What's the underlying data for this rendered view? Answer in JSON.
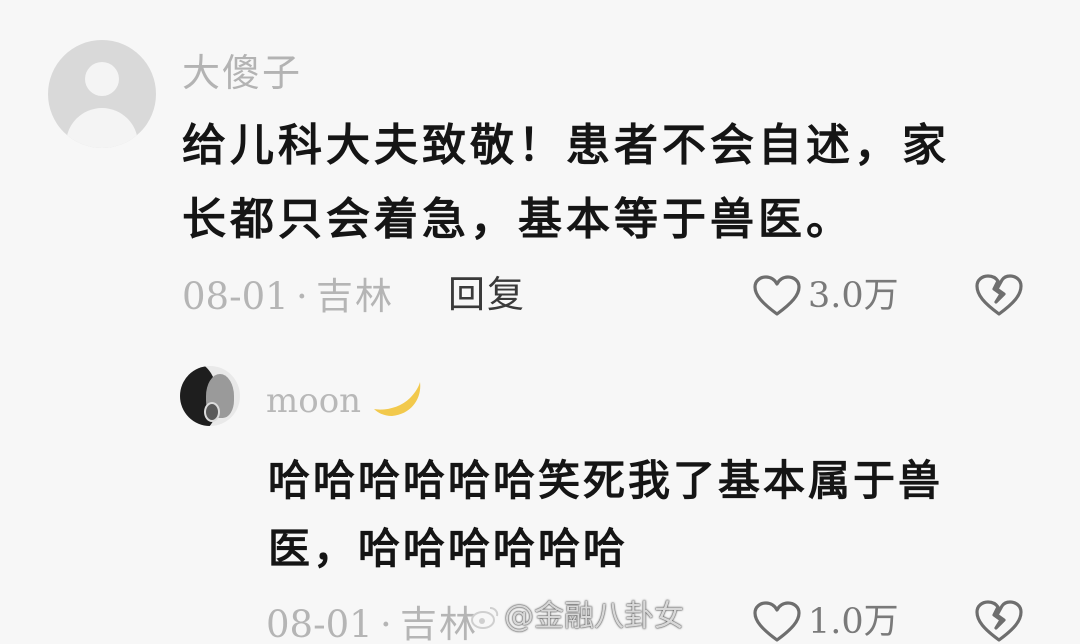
{
  "comment1": {
    "username": "大傻子",
    "text_line1": "给儿科大夫致敬！患者不会自述，家",
    "text_line2": "长都只会着急，基本等于兽医。",
    "date": "08-01",
    "separator": "·",
    "location": "吉林",
    "reply_label": "回复",
    "like_count": "3.0万",
    "avatar_icon": "default-user-icon",
    "like_icon": "heart-outline-icon",
    "dislike_icon": "broken-heart-icon"
  },
  "comment2": {
    "username": "moon",
    "username_emoji": "crescent-moon-icon",
    "text_line1": "哈哈哈哈哈哈笑死我了基本属于兽",
    "text_line2": "医，哈哈哈哈哈哈",
    "date": "08-01",
    "separator": "·",
    "location": "吉林",
    "like_count": "1.0万",
    "avatar_icon": "profile-photo",
    "like_icon": "heart-outline-icon",
    "dislike_icon": "broken-heart-icon"
  },
  "watermark": {
    "text": "@金融八卦女",
    "logo_icon": "weibo-logo-icon"
  },
  "colors": {
    "background": "#f7f7f7",
    "username": "#b3b3b3",
    "comment_text": "#151515",
    "meta_text": "#b5b5b5",
    "moon": "#f2c94c"
  }
}
